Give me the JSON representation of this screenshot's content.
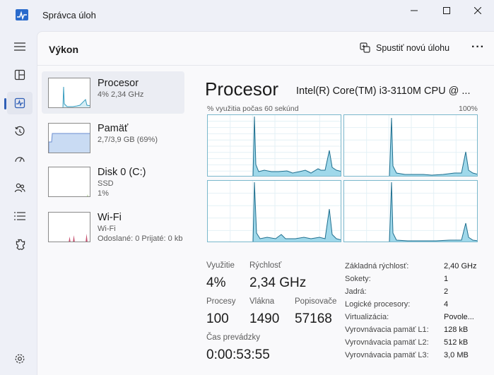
{
  "window": {
    "title": "Správca úloh"
  },
  "header": {
    "title": "Výkon",
    "run_task_label": "Spustiť novú úlohu",
    "more_label": "···"
  },
  "nav": {
    "items": [
      {
        "icon": "hamburger-icon"
      },
      {
        "icon": "processes-icon"
      },
      {
        "icon": "performance-icon",
        "active": true
      },
      {
        "icon": "app-history-icon"
      },
      {
        "icon": "startup-apps-icon"
      },
      {
        "icon": "users-icon"
      },
      {
        "icon": "details-icon"
      },
      {
        "icon": "services-icon"
      },
      {
        "icon": "settings-icon"
      }
    ]
  },
  "devices": [
    {
      "name": "Procesor",
      "sub1": "4% 2,34 GHz"
    },
    {
      "name": "Pamäť",
      "sub1": "2,7/3,9 GB (69%)"
    },
    {
      "name": "Disk 0 (C:)",
      "sub1": "SSD",
      "sub2": "1%"
    },
    {
      "name": "Wi-Fi",
      "sub1": "Wi-Fi",
      "sub2": "Odoslané: 0 Prijaté: 0 kb"
    }
  ],
  "detail": {
    "title": "Procesor",
    "model": "Intel(R) Core(TM) i3-3110M CPU @ ...",
    "graph_caption": "% využitia počas 60 sekúnd",
    "graph_max": "100%",
    "stats": {
      "usage_label": "Využitie",
      "usage": "4%",
      "speed_label": "Rýchlosť",
      "speed": "2,34 GHz",
      "processes_label": "Procesy",
      "processes": "100",
      "threads_label": "Vlákna",
      "threads": "1490",
      "handles_label": "Popisovače",
      "handles": "57168",
      "uptime_label": "Čas prevádzky",
      "uptime": "0:00:53:55"
    },
    "specs": [
      {
        "key": "Základná rýchlosť:",
        "value": "2,40 GHz"
      },
      {
        "key": "Sokety:",
        "value": "1"
      },
      {
        "key": "Jadrá:",
        "value": "2"
      },
      {
        "key": "Logické procesory:",
        "value": "4"
      },
      {
        "key": "Virtualizácia:",
        "value": "Povole..."
      },
      {
        "key": "Vyrovnávacia pamäť L1:",
        "value": "128 kB"
      },
      {
        "key": "Vyrovnávacia pamäť L2:",
        "value": "512 kB"
      },
      {
        "key": "Vyrovnávacia pamäť L3:",
        "value": "3,0 MB"
      }
    ],
    "core_usage": [
      [
        0,
        0,
        0,
        0,
        0,
        0,
        0,
        0,
        0,
        0,
        0,
        0,
        0,
        0,
        0,
        0,
        0,
        0,
        0,
        0,
        0,
        0,
        0,
        0,
        0,
        0,
        0,
        0,
        0,
        0,
        0,
        0,
        0,
        0,
        0,
        0,
        0,
        0,
        0,
        0,
        0,
        0,
        0,
        0,
        0,
        0,
        0,
        0,
        0,
        0,
        0,
        0,
        0,
        0,
        0,
        0,
        0,
        0,
        0,
        0,
        0,
        0,
        0,
        0,
        0,
        0,
        0,
        0,
        0,
        0,
        0,
        0,
        0,
        0,
        0,
        0,
        0,
        0,
        0,
        0,
        0,
        0,
        0,
        0,
        0,
        0,
        0,
        0,
        0,
        0,
        0,
        0,
        0,
        0,
        0,
        0,
        0,
        0,
        0,
        0,
        0,
        0,
        0,
        0,
        0,
        0,
        0,
        0,
        0,
        0,
        0,
        0,
        0,
        0,
        0,
        0,
        0,
        0,
        0,
        0,
        0,
        0,
        0,
        0,
        0,
        0,
        0,
        0,
        0,
        0,
        0,
        0,
        0,
        0,
        0,
        0,
        0,
        0,
        0,
        0,
        0,
        0,
        0,
        0,
        0,
        0,
        0,
        0,
        0,
        0,
        0,
        0,
        0,
        0,
        0,
        0,
        0,
        0,
        0,
        0
      ],
      [
        0
      ],
      [
        0
      ],
      [
        0
      ]
    ]
  }
}
